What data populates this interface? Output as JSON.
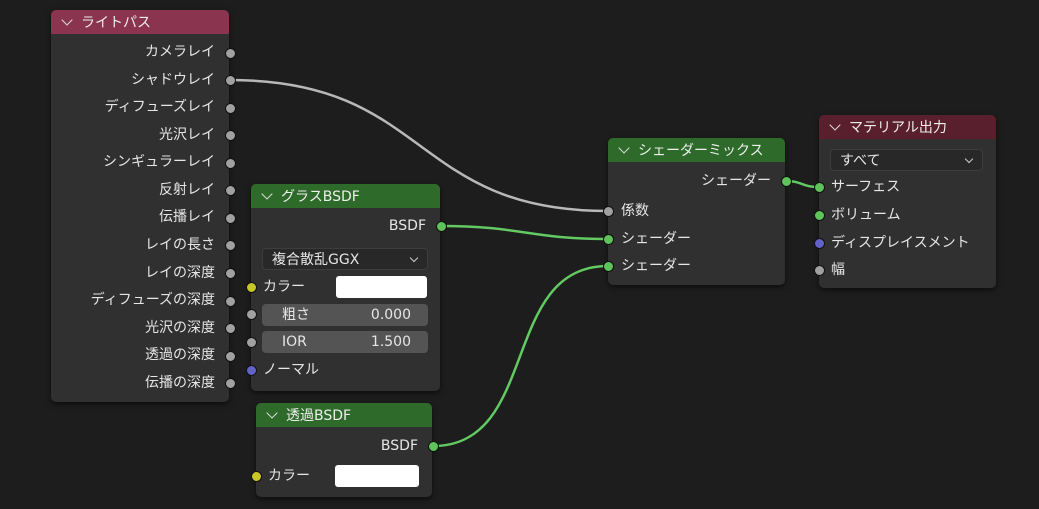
{
  "nodes": {
    "light_path": {
      "title": "ライトパス",
      "outputs": [
        "カメラレイ",
        "シャドウレイ",
        "ディフューズレイ",
        "光沢レイ",
        "シンギュラーレイ",
        "反射レイ",
        "伝播レイ",
        "レイの長さ",
        "レイの深度",
        "ディフューズの深度",
        "光沢の深度",
        "透過の深度",
        "伝播の深度"
      ]
    },
    "glass_bsdf": {
      "title": "グラスBSDF",
      "output": "BSDF",
      "distribution": "複合散乱GGX",
      "color_label": "カラー",
      "roughness_label": "粗さ",
      "roughness_value": "0.000",
      "ior_label": "IOR",
      "ior_value": "1.500",
      "normal_label": "ノーマル",
      "color_value": "#ffffff"
    },
    "transparent_bsdf": {
      "title": "透過BSDF",
      "output": "BSDF",
      "color_label": "カラー",
      "color_value": "#ffffff"
    },
    "mix_shader": {
      "title": "シェーダーミックス",
      "output": "シェーダー",
      "inputs": [
        "係数",
        "シェーダー",
        "シェーダー"
      ]
    },
    "material_output": {
      "title": "マテリアル出力",
      "target": "すべて",
      "inputs": [
        "サーフェス",
        "ボリューム",
        "ディスプレイスメント",
        "幅"
      ]
    }
  },
  "colors": {
    "background": "#1d1d1d",
    "node_body": "#303030",
    "input_header": "#8a344f",
    "shader_header": "#2e6b2a",
    "output_header": "#5a1f2c",
    "socket_shader": "#5fc35c",
    "socket_float": "#a1a1a1",
    "socket_color": "#c7c729",
    "socket_vector": "#6363c7",
    "link_float": "#b8b8b8",
    "link_shader": "#63c963"
  }
}
